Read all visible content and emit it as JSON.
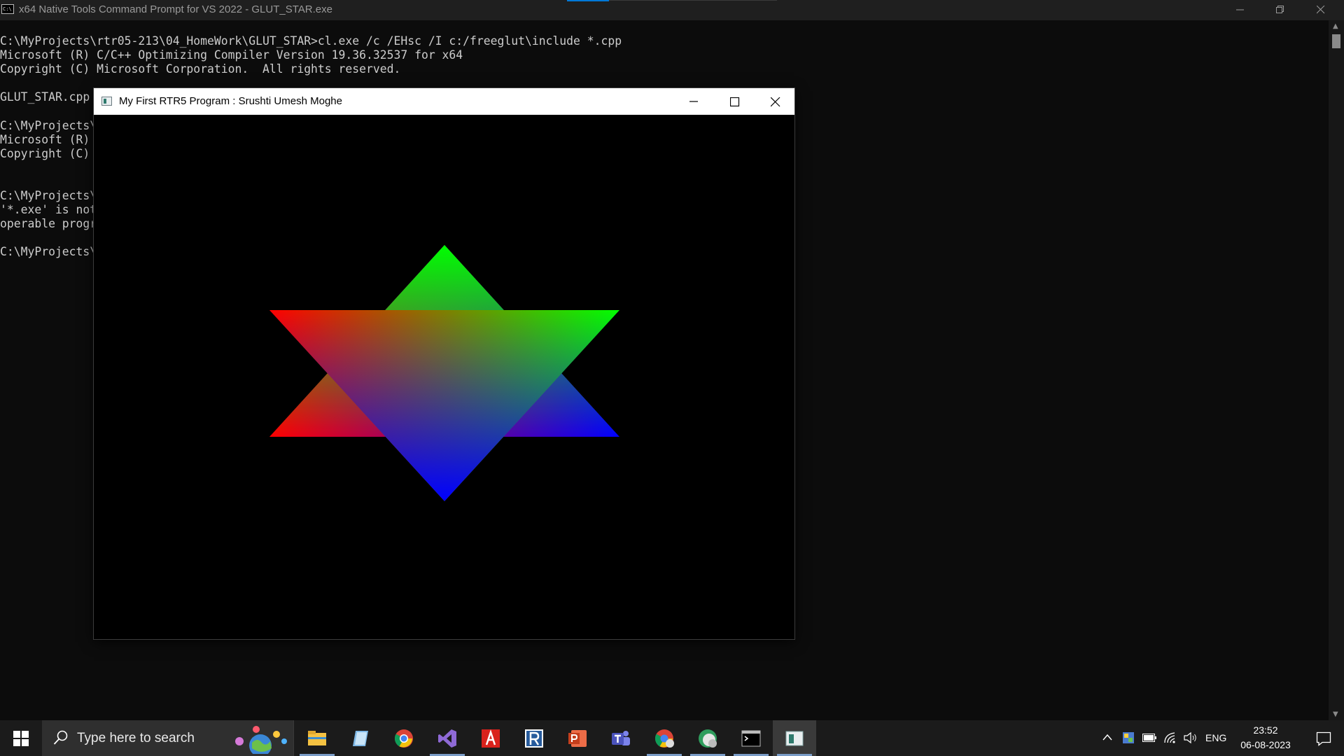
{
  "console": {
    "title": "x64 Native Tools Command Prompt for VS 2022 - GLUT_STAR.exe",
    "lines": [
      "C:\\MyProjects\\rtr05-213\\04_HomeWork\\GLUT_STAR>cl.exe /c /EHsc /I c:/freeglut\\include *.cpp",
      "Microsoft (R) C/C++ Optimizing Compiler Version 19.36.32537 for x64",
      "Copyright (C) Microsoft Corporation.  All rights reserved.",
      "",
      "GLUT_STAR.cpp",
      "",
      "C:\\MyProjects\\r",
      "Microsoft (R) I",
      "Copyright (C) M",
      "",
      "",
      "C:\\MyProjects\\r",
      "'*.exe' is not",
      "operable progra",
      "",
      "C:\\MyProjects\\r"
    ]
  },
  "glut_window": {
    "title": "My First RTR5 Program : Srushti Umesh Moghe",
    "star": {
      "up_triangle_colors": {
        "top": "#00ff00",
        "left": "#ff0000",
        "right": "#0000ff"
      },
      "down_triangle_colors": {
        "left": "#ff0000",
        "right": "#00ff00",
        "bottom": "#0000ff"
      }
    }
  },
  "taskbar": {
    "search_placeholder": "Type here to search",
    "apps": [
      "file-explorer-icon",
      "notepad-icon",
      "chrome-icon",
      "visual-studio-icon",
      "acrobat-icon",
      "rider-icon",
      "powerpoint-icon",
      "teams-icon",
      "chrome-profile-icon",
      "edge-icon",
      "terminal-icon",
      "glut-app-icon"
    ],
    "language": "ENG",
    "time": "23:52",
    "date": "06-08-2023"
  },
  "colors": {
    "console_bg": "#0c0c0c",
    "console_text": "#cccccc",
    "taskbar_bg": "#1b1b1b",
    "accent": "#0078d7"
  }
}
